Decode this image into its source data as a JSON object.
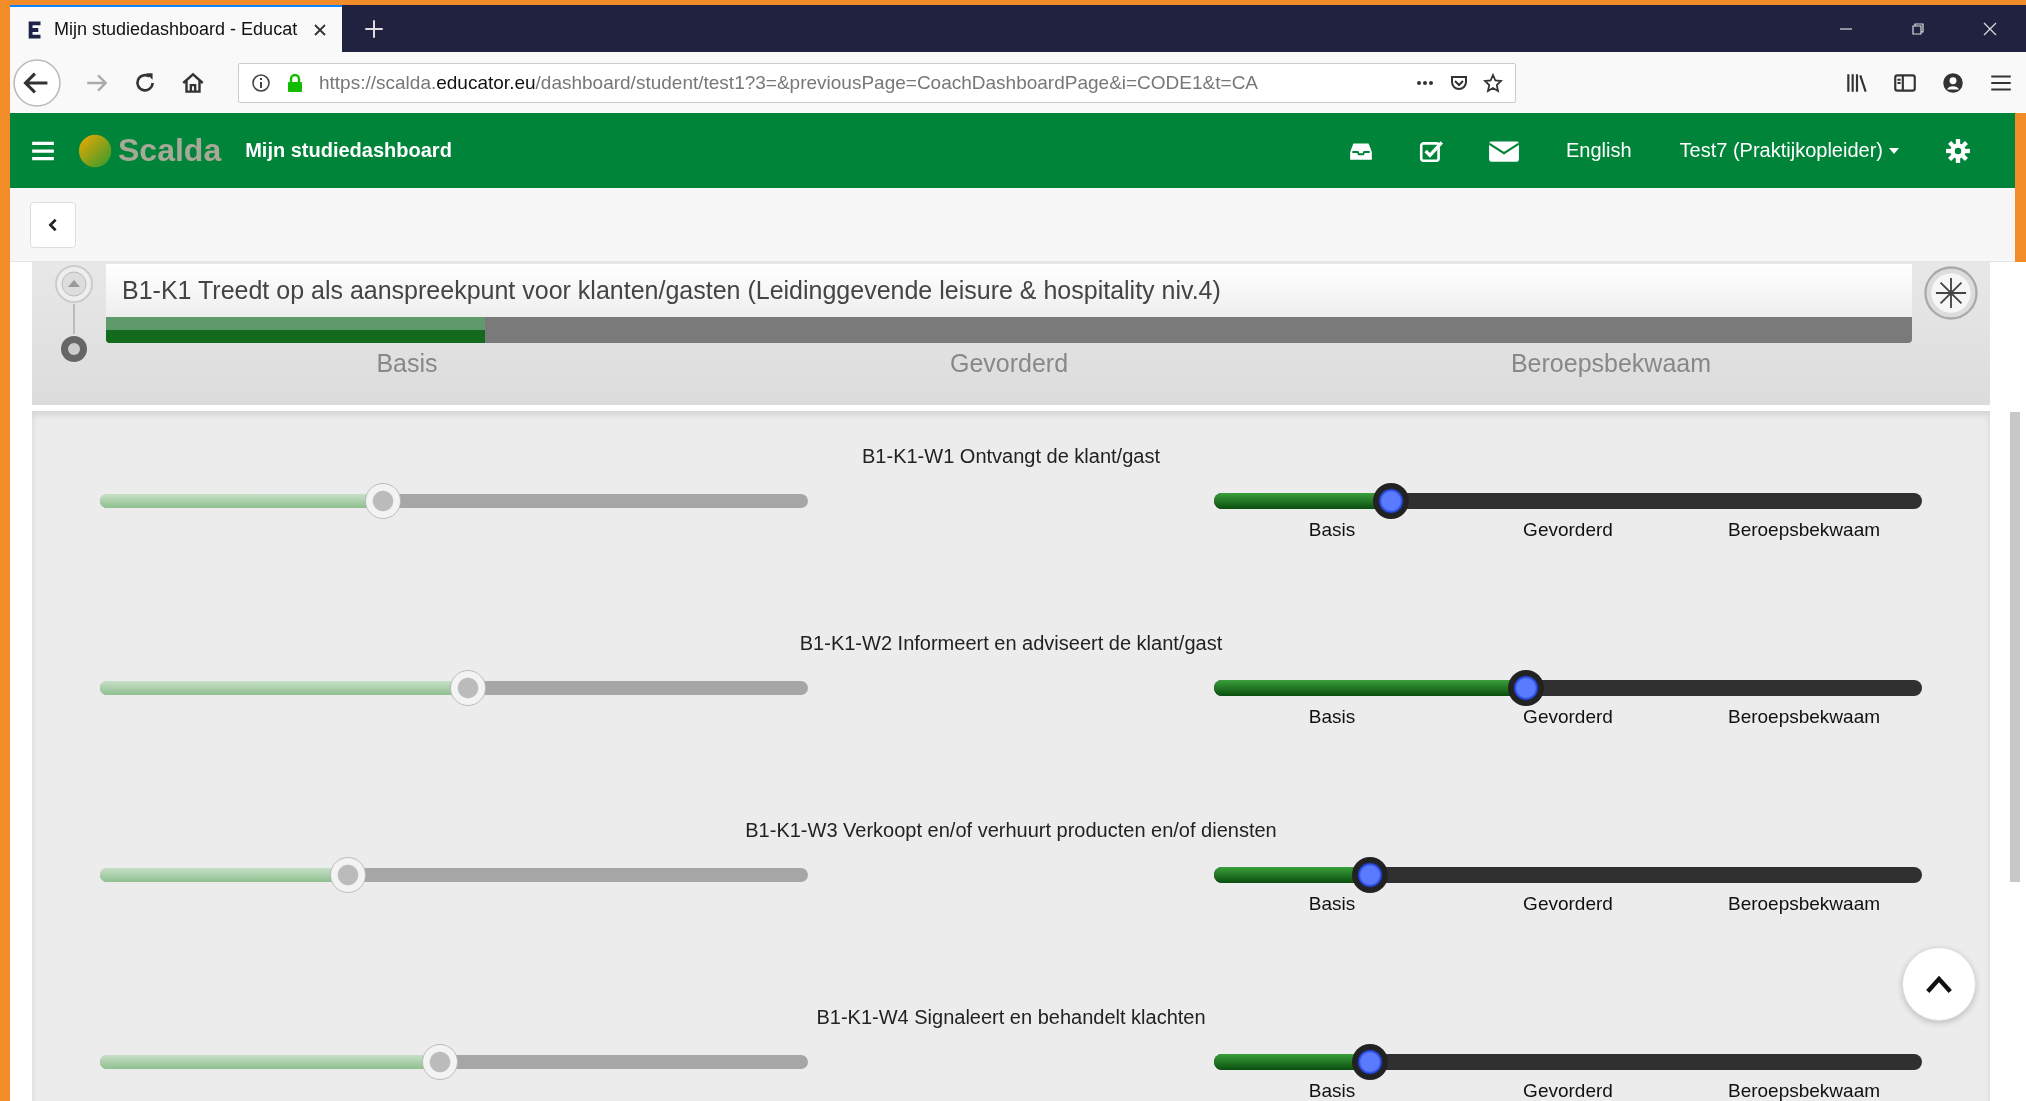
{
  "browser": {
    "tab_title": "Mijn studiedashboard - Educat",
    "url": {
      "scheme": "https://scalda.",
      "domain": "educator.eu",
      "path": "/dashboard/student/test1?3=&previousPage=CoachDashboardPage&i=CODE1&t=CA"
    }
  },
  "header": {
    "logo_text": "Scalda",
    "title": "Mijn studiedashboard",
    "language": "English",
    "user": "Test7 (Praktijkopleider)"
  },
  "competency": {
    "title": "B1-K1 Treedt op als aanspreekpunt voor klanten/gasten (Leidinggevende leisure & hospitality niv.4)",
    "level": 0.21,
    "scale": [
      "Basis",
      "Gevorderd",
      "Beroepsbekwaam"
    ]
  },
  "work_processes": [
    {
      "title": "B1-K1-W1 Ontvangt de klant/gast",
      "left_slider": {
        "level": 0.4
      },
      "right_slider": {
        "level": 0.25
      },
      "scale": [
        "Basis",
        "Gevorderd",
        "Beroepsbekwaam"
      ]
    },
    {
      "title": "B1-K1-W2 Informeert en adviseert de klant/gast",
      "left_slider": {
        "level": 0.52
      },
      "right_slider": {
        "level": 0.44
      },
      "scale": [
        "Basis",
        "Gevorderd",
        "Beroepsbekwaam"
      ]
    },
    {
      "title": "B1-K1-W3 Verkoopt en/of verhuurt producten en/of diensten",
      "left_slider": {
        "level": 0.35
      },
      "right_slider": {
        "level": 0.22
      },
      "scale": [
        "Basis",
        "Gevorderd",
        "Beroepsbekwaam"
      ]
    },
    {
      "title": "B1-K1-W4 Signaleert en behandelt klachten",
      "left_slider": {
        "level": 0.48
      },
      "right_slider": {
        "level": 0.22
      },
      "scale": [
        "Basis",
        "Gevorderd",
        "Beroepsbekwaam"
      ]
    }
  ]
}
